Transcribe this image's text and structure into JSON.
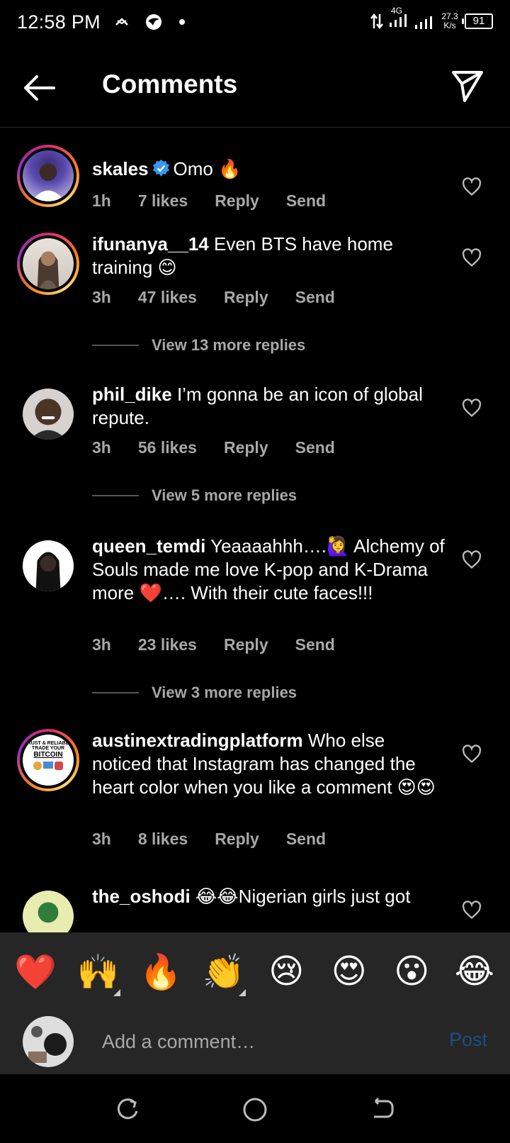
{
  "status": {
    "time": "12:58 PM",
    "network": "4G",
    "speed_value": "27.3",
    "speed_unit": "K/s",
    "battery": "91"
  },
  "header": {
    "title": "Comments"
  },
  "comments": [
    {
      "username": "skales",
      "verified": true,
      "text": "Omo 🔥",
      "time": "1h",
      "likes": "7 likes",
      "reply": "Reply",
      "send": "Send"
    },
    {
      "username": "ifunanya__14",
      "text": "Even BTS have home training 😊",
      "time": "3h",
      "likes": "47 likes",
      "reply": "Reply",
      "send": "Send",
      "view_replies": "View 13 more replies"
    },
    {
      "username": "phil_dike",
      "text": "I’m gonna be an icon of global repute.",
      "time": "3h",
      "likes": "56 likes",
      "reply": "Reply",
      "send": "Send",
      "view_replies": "View 5 more replies"
    },
    {
      "username": "queen_temdi",
      "text": "Yeaaaahhh….🙋‍♀️ Alchemy of Souls made me love K-pop and K-Drama more ❤️…. With their cute faces!!!",
      "time": "3h",
      "likes": "23 likes",
      "reply": "Reply",
      "send": "Send",
      "view_replies": "View 3 more replies"
    },
    {
      "username": "austinextradingplatform",
      "text": "Who else noticed that Instagram has changed the heart color when you like a comment 😍😍",
      "time": "3h",
      "likes": "8 likes",
      "reply": "Reply",
      "send": "Send",
      "avatar_text_1": "TRUST & RELIABLE",
      "avatar_text_2": "TRADE YOUR",
      "avatar_text_3": "BITCOIN"
    },
    {
      "username": "the_oshodi",
      "text": "😂😂Nigerian girls just got"
    }
  ],
  "emoji_bar": [
    "❤️",
    "🙌",
    "🔥",
    "👏",
    "😢",
    "😍",
    "😮",
    "😂"
  ],
  "composer": {
    "placeholder": "Add a comment…",
    "post_label": "Post"
  }
}
